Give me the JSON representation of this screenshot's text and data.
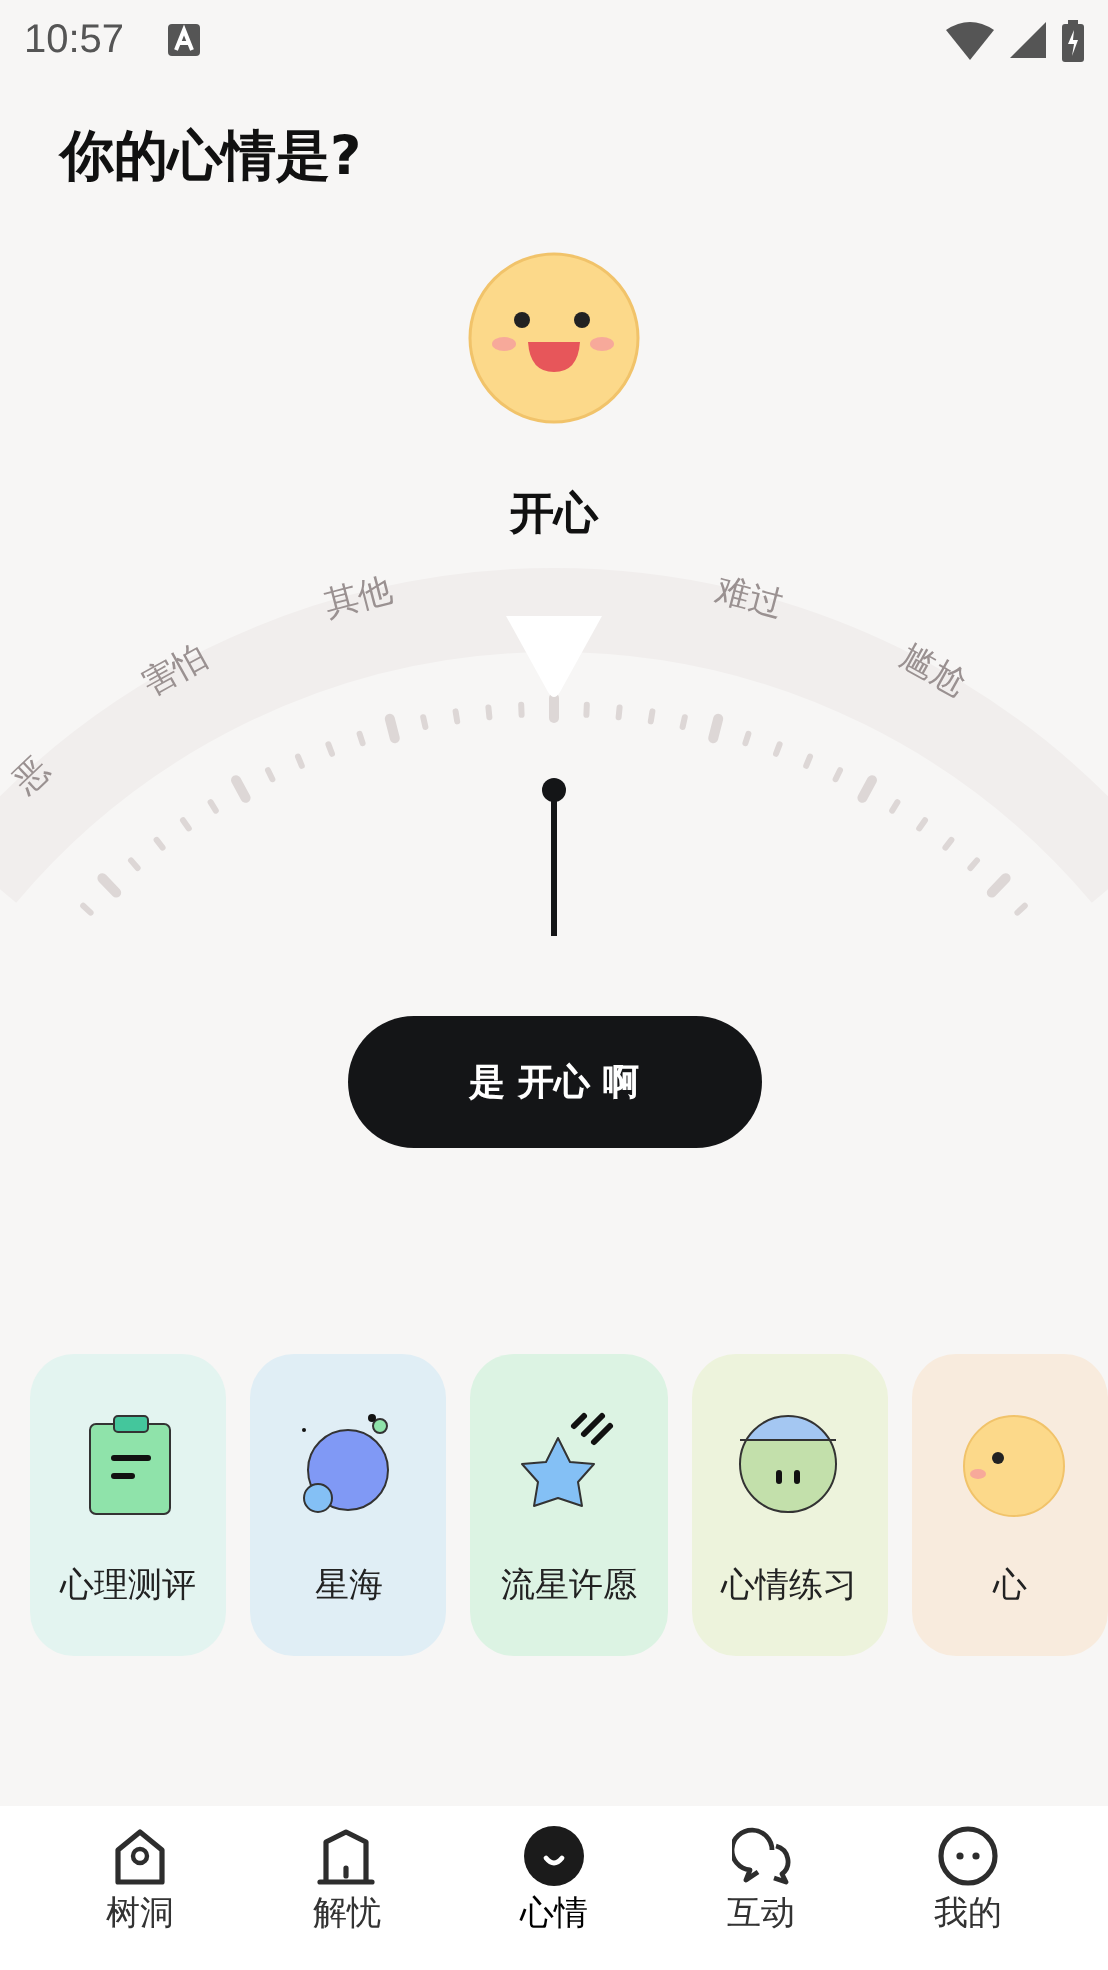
{
  "status_bar": {
    "time": "10:57"
  },
  "title": "你的心情是?",
  "mood": {
    "name": "开心"
  },
  "dial": {
    "labels": [
      {
        "text": "恶"
      },
      {
        "text": "害怕"
      },
      {
        "text": "其他"
      },
      {
        "text": "难过"
      },
      {
        "text": "尴尬"
      }
    ]
  },
  "confirm_button": "是 开心 啊",
  "cards": [
    {
      "label": "心理测评",
      "kind": "clipboard",
      "color": "#e3f4f0"
    },
    {
      "label": "星海",
      "kind": "planet",
      "color": "#e0eef5"
    },
    {
      "label": "流星许愿",
      "kind": "star",
      "color": "#dcf3e3"
    },
    {
      "label": "心情练习",
      "kind": "ball",
      "color": "#edf3dc"
    },
    {
      "label": "心",
      "kind": "face",
      "color": "#f8ebdd"
    }
  ],
  "nav": [
    {
      "label": "树洞",
      "kind": "home",
      "selected": false
    },
    {
      "label": "解忧",
      "kind": "hut",
      "selected": false
    },
    {
      "label": "心情",
      "kind": "mood",
      "selected": true
    },
    {
      "label": "互动",
      "kind": "chat",
      "selected": false
    },
    {
      "label": "我的",
      "kind": "me",
      "selected": false
    }
  ]
}
